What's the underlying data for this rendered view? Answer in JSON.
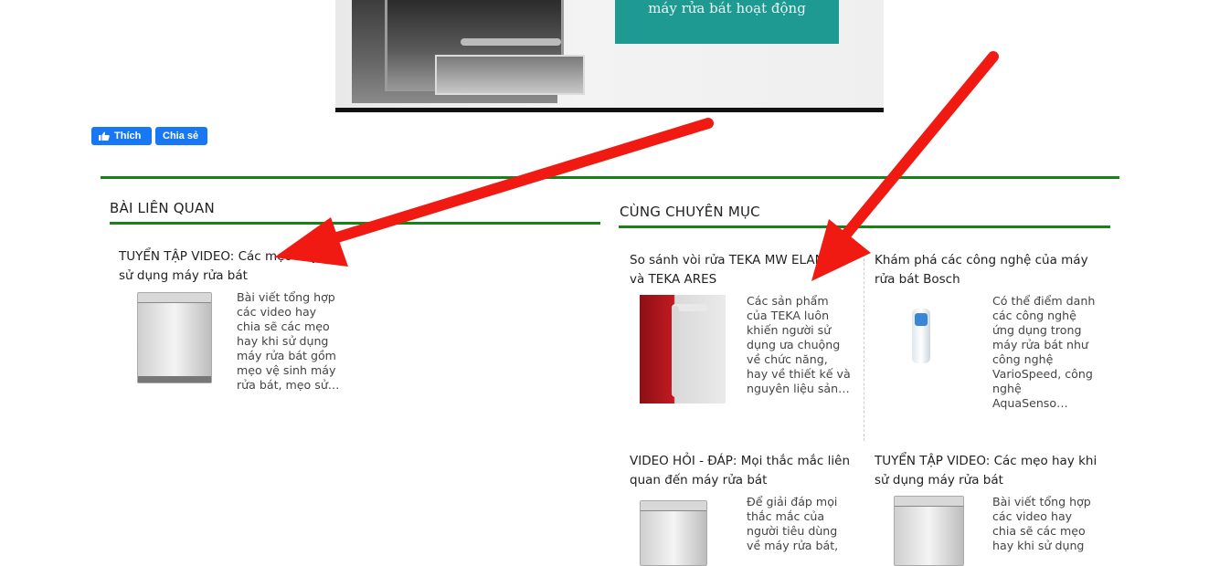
{
  "banner": {
    "caption": "máy rửa bát hoạt động"
  },
  "social": {
    "like_label": "Thích",
    "share_label": "Chia sẻ"
  },
  "related": {
    "title": "BÀI LIÊN QUAN",
    "posts": [
      {
        "title": "TUYỂN TẬP VIDEO: Các mẹo hay khi sử dụng máy rửa bát",
        "excerpt": "Bài viết tổng hợp các video hay chia sẽ các mẹo hay khi sử dụng máy rửa bát gồm mẹo vệ sinh máy rửa bát, mẹo sử…",
        "thumb_icon": "dishwasher-image"
      }
    ]
  },
  "category": {
    "title": "CÙNG CHUYÊN MỤC",
    "posts": [
      {
        "title": "So sánh vòi rửa TEKA MW ELAN và TEKA ARES",
        "excerpt": "Các sản phẩm của TEKA luôn khiến người sử dụng ưa chuộng về chức năng, hay về thiết kế và nguyên liệu sản…",
        "thumb_icon": "faucet-image"
      },
      {
        "title": "Khám phá các công nghệ của máy rửa bát Bosch",
        "excerpt": "Có thể điểm danh các công nghệ ứng dụng trong máy rửa bát như công nghệ VarioSpeed, công nghệ AquaSenso…",
        "thumb_icon": "valve-image"
      },
      {
        "title": "VIDEO HỎI - ĐÁP: Mọi thắc mắc liên quan đến máy rửa bát",
        "excerpt": "Để giải đáp mọi thắc mắc của người tiêu dùng về máy rửa bát,",
        "thumb_icon": "dishwasher-image"
      },
      {
        "title": "TUYỂN TẬP VIDEO: Các mẹo hay khi sử dụng máy rửa bát",
        "excerpt": "Bài viết tổng hợp các video hay chia sẽ các mẹo hay khi sử dụng",
        "thumb_icon": "dishwasher-image"
      }
    ]
  },
  "colors": {
    "accent_green": "#148414",
    "fb_blue": "#1877f2",
    "annotation_red": "#f01a12",
    "banner_teal": "#1f9a93"
  },
  "annotations": {
    "arrow_icon": "red-arrow-icon"
  }
}
